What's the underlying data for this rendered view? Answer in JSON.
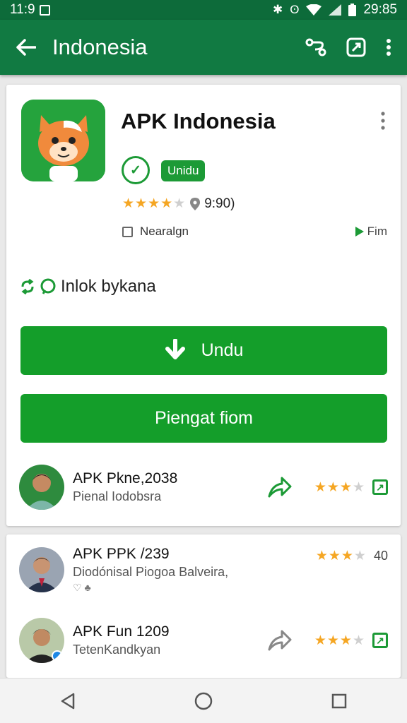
{
  "status_bar": {
    "time": "11:9",
    "clock": "29:85"
  },
  "app_bar": {
    "title": "Indonesia"
  },
  "app": {
    "title": "APK Indonesia",
    "badge": "Unidu",
    "verify_glyph": "✓",
    "rating_value": 3.5,
    "rating_text": "9:90)",
    "meta_left": "Nearalgn",
    "meta_right": "Fim",
    "tagline": "Inlok bykana"
  },
  "buttons": {
    "primary": "Undu",
    "secondary": "Piengat fiom"
  },
  "rows": [
    {
      "title": "APK Pkne,2038",
      "subtitle": "Pienal Iodobsra",
      "extra": "",
      "rating": 3.5,
      "count": ""
    },
    {
      "title": "APK PPK /239",
      "subtitle": "Diodónisal Piogoa Balveira,",
      "extra": "♡ ♣",
      "rating": 3.5,
      "count": "40"
    },
    {
      "title": "APK Fun 1209",
      "subtitle": "TetenKandkyan",
      "extra": "",
      "rating": 3.5,
      "count": ""
    }
  ],
  "colors": {
    "status_bar": "#0d6b3a",
    "app_bar": "#117a42",
    "accent_green": "#149e2a",
    "star": "#f5a623"
  },
  "icons": [
    "back-arrow-icon",
    "route-icon",
    "navigation-icon",
    "more-vert-icon",
    "download-arrow-icon",
    "share-arrow-icon",
    "location-pin-icon"
  ]
}
